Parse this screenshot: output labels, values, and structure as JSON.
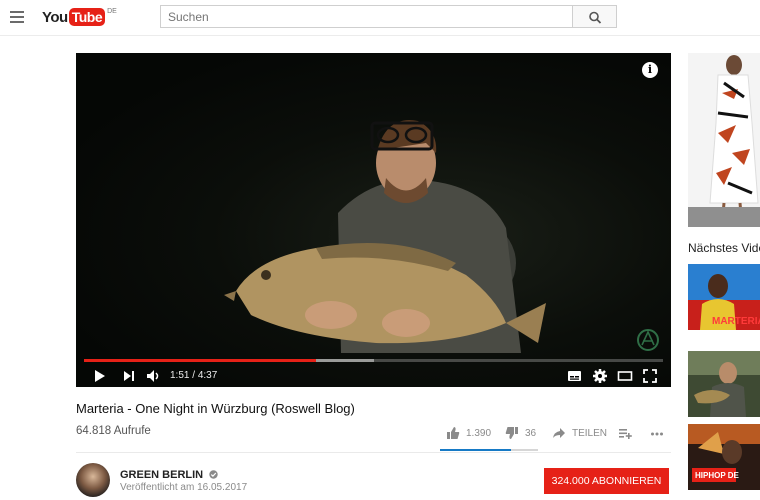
{
  "header": {
    "logo_you": "You",
    "logo_tube": "Tube",
    "logo_region": "DE",
    "search_placeholder": "Suchen"
  },
  "player": {
    "current_time": "1:51",
    "duration": "4:37",
    "played_fraction": 0.4,
    "buffered_fraction": 0.5
  },
  "video": {
    "title": "Marteria - One Night in Würzburg (Roswell Blog)",
    "views": "64.818 Aufrufe",
    "likes": "1.390",
    "dislikes": "36",
    "share_label": "TEILEN",
    "like_fraction": 0.72
  },
  "channel": {
    "name": "GREEN BERLIN",
    "published": "Veröffentlicht am 16.05.2017",
    "subscribe_label": "324.000 ABONNIEREN"
  },
  "sidebar": {
    "up_next_label": "Nächstes Vide",
    "thumb1_overlay": "MARTERIA",
    "thumb3_overlay": "HIPHOP DE"
  },
  "colors": {
    "brand_red": "#e62117",
    "like_blue": "#167ac6"
  }
}
